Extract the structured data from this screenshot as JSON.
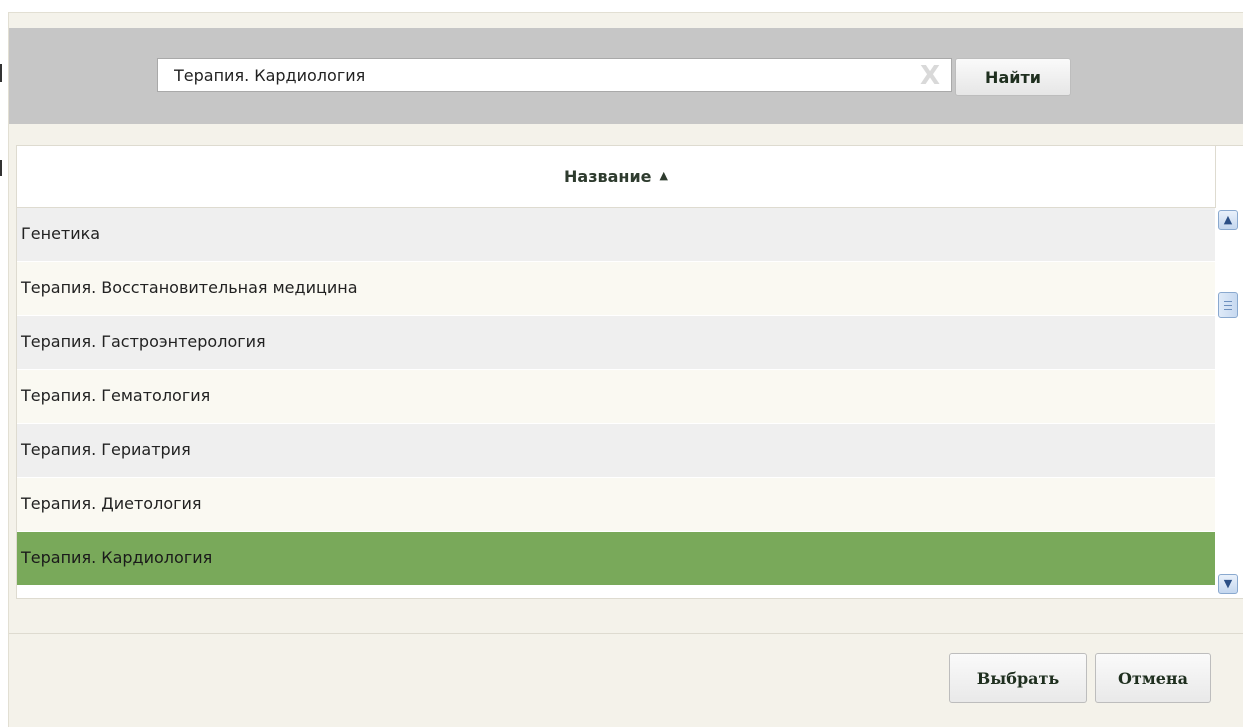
{
  "search": {
    "value": "Терапия. Кардиология",
    "clear_glyph": "X",
    "find_label": "Найти"
  },
  "grid": {
    "column_header": "Название",
    "sort_glyph": "▲",
    "rows": [
      {
        "label": "Генетика",
        "selected": false
      },
      {
        "label": "Терапия. Восстановительная медицина",
        "selected": false
      },
      {
        "label": "Терапия. Гастроэнтерология",
        "selected": false
      },
      {
        "label": "Терапия. Гематология",
        "selected": false
      },
      {
        "label": "Терапия. Гериатрия",
        "selected": false
      },
      {
        "label": "Терапия. Диетология",
        "selected": false
      },
      {
        "label": "Терапия. Кардиология",
        "selected": true
      }
    ],
    "scroll_up_glyph": "▲",
    "scroll_down_glyph": "▼"
  },
  "footer": {
    "select_label": "Выбрать",
    "cancel_label": "Отмена"
  },
  "colors": {
    "selected_row": "#79a95a",
    "search_band": "#c6c6c6",
    "dialog_bg": "#f4f2ea"
  }
}
